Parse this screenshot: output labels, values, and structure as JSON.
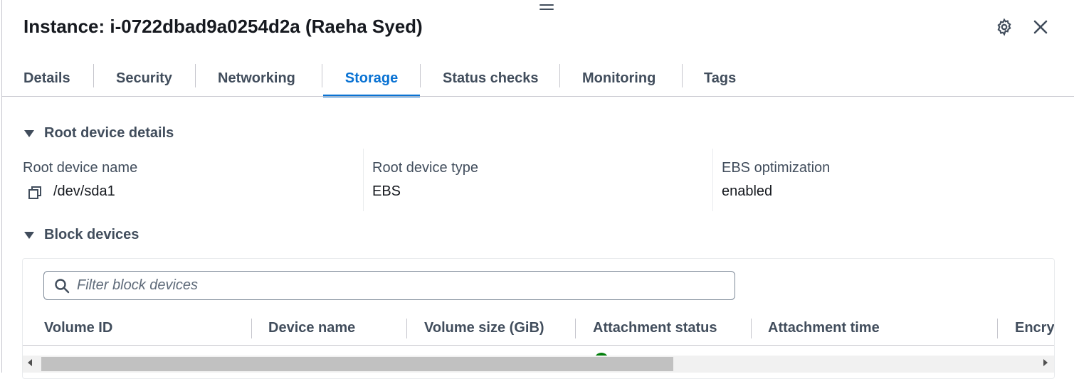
{
  "header": {
    "title": "Instance: i-0722dbad9a0254d2a (Raeha Syed)",
    "settings_icon": "gear-icon",
    "close_icon": "close-icon"
  },
  "tabs": [
    {
      "label": "Details",
      "active": false
    },
    {
      "label": "Security",
      "active": false
    },
    {
      "label": "Networking",
      "active": false
    },
    {
      "label": "Storage",
      "active": true
    },
    {
      "label": "Status checks",
      "active": false
    },
    {
      "label": "Monitoring",
      "active": false
    },
    {
      "label": "Tags",
      "active": false
    }
  ],
  "root_device": {
    "heading": "Root device details",
    "name_label": "Root device name",
    "name_value": "/dev/sda1",
    "type_label": "Root device type",
    "type_value": "EBS",
    "ebs_label": "EBS optimization",
    "ebs_value": "enabled"
  },
  "block_devices": {
    "heading": "Block devices",
    "filter_placeholder": "Filter block devices",
    "columns": [
      "Volume ID",
      "Device name",
      "Volume size (GiB)",
      "Attachment status",
      "Attachment time",
      "Encry"
    ]
  },
  "colors": {
    "accent": "#0972d3",
    "text": "#16191f",
    "muted": "#414d5c"
  }
}
